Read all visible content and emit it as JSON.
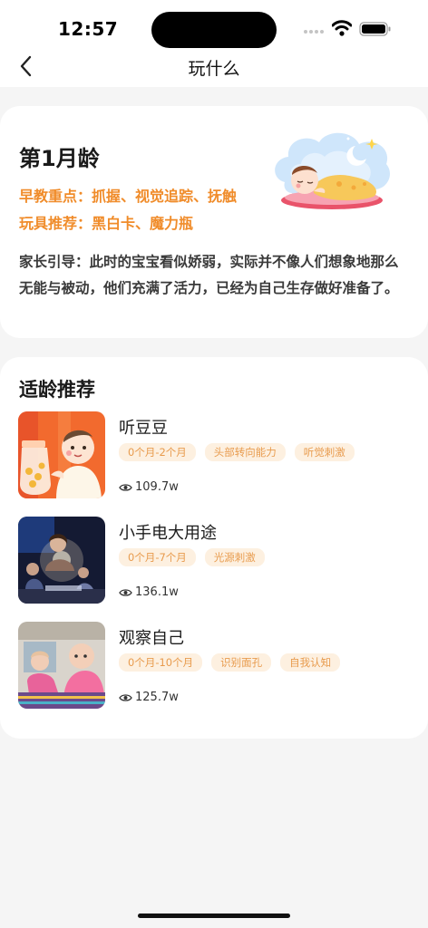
{
  "status_bar": {
    "time": "12:57"
  },
  "nav": {
    "title": "玩什么",
    "back_icon": "chevron-left-icon"
  },
  "age_card": {
    "title": "第1月龄",
    "focus": "早教重点：抓握、视觉追踪、抚触",
    "toys": "玩具推荐：黑白卡、魔力瓶",
    "guide": "家长引导：此时的宝宝看似娇弱，实际并不像人们想象地那么无能与被动，他们充满了活力，已经为自己生存做好准备了。"
  },
  "recommend": {
    "title": "适龄推荐",
    "items": [
      {
        "name": "听豆豆",
        "tags": [
          "0个月-2个月",
          "头部转向能力",
          "听觉刺激"
        ],
        "views": "109.7w"
      },
      {
        "name": "小手电大用途",
        "tags": [
          "0个月-7个月",
          "光源刺激"
        ],
        "views": "136.1w"
      },
      {
        "name": "观察自己",
        "tags": [
          "0个月-10个月",
          "识别面孔",
          "自我认知"
        ],
        "views": "125.7w"
      }
    ]
  },
  "colors": {
    "accent": "#f08c2a",
    "tag_bg": "#fdf0e0",
    "tag_text": "#e89b4d"
  }
}
